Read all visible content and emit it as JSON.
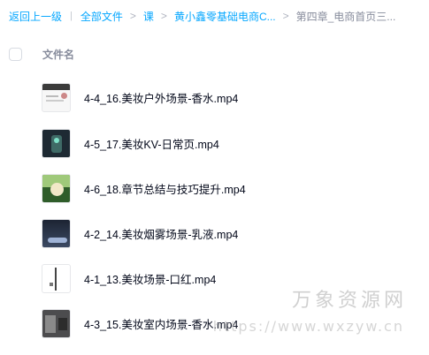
{
  "breadcrumb": {
    "back": "返回上一级",
    "all_files": "全部文件",
    "crumb1": "课",
    "crumb2": "黄小鑫零基础电商C...",
    "current": "第四章_电商首页三...",
    "separator": ">",
    "pipe": "|"
  },
  "header": {
    "column_name": "文件名"
  },
  "files": [
    {
      "name": "4-4_16.美妆户外场景-香水.mp4"
    },
    {
      "name": "4-5_17.美妆KV-日常页.mp4"
    },
    {
      "name": "4-6_18.章节总结与技巧提升.mp4"
    },
    {
      "name": "4-2_14.美妆烟雾场景-乳液.mp4"
    },
    {
      "name": "4-1_13.美妆场景-口红.mp4"
    },
    {
      "name": "4-3_15.美妆室内场景-香水.mp4"
    }
  ],
  "watermark": {
    "text": "万象资源网",
    "url": "https://www.wxzyw.cn"
  },
  "colors": {
    "link": "#06a7ff",
    "muted": "#878c9c",
    "text": "#03081a"
  }
}
